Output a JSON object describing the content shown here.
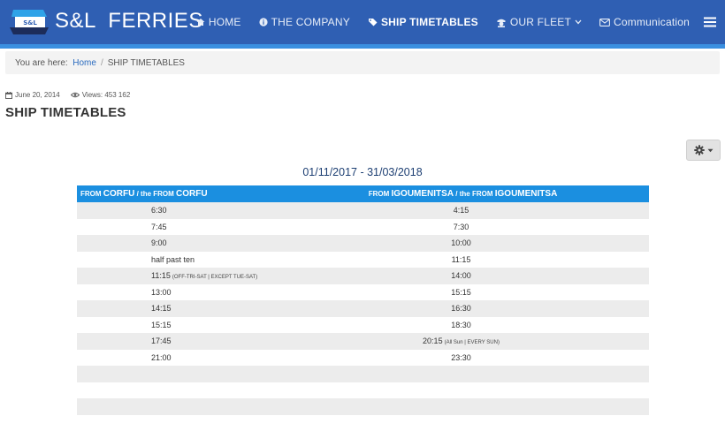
{
  "brand": {
    "name": "S&L  FERRIES",
    "logo_text": "S&L"
  },
  "nav": {
    "items": [
      {
        "label": "HOME",
        "icon": "home-icon"
      },
      {
        "label": "THE COMPANY",
        "icon": "info-circle-icon"
      },
      {
        "label": "SHIP TIMETABLES",
        "icon": "tag-icon",
        "active": true
      },
      {
        "label": "OUR FLEET",
        "icon": "captain-icon"
      },
      {
        "label": "Communication",
        "icon": "envelope-icon"
      }
    ],
    "menu_icon": "hamburger-menu-icon"
  },
  "breadcrumb": {
    "prefix": "You are here:",
    "home": "Home",
    "current": "SHIP TIMETABLES"
  },
  "article": {
    "date": "June 20, 2014",
    "views": "Views: 453 162",
    "title": "SHIP TIMETABLES",
    "tools_icon": "gear-icon"
  },
  "timetable": {
    "period": "01/11/2017 - 31/03/2018",
    "col1_small_a": "FROM",
    "col1_big": "CORFU",
    "col1_small_b": "/ the FROM",
    "col1_big_b": "CORFU",
    "col2_small_a": "FROM",
    "col2_big": "IGOUMENITSA",
    "col2_small_b": "/ the FROM",
    "col2_big_b": "IGOUMENITSA",
    "rows": [
      {
        "corfu": "6:30",
        "corfu_note": "",
        "igoumenitsa": "4:15",
        "igoumenitsa_note": ""
      },
      {
        "corfu": "7:45",
        "corfu_note": "",
        "igoumenitsa": "7:30",
        "igoumenitsa_note": ""
      },
      {
        "corfu": "9:00",
        "corfu_note": "",
        "igoumenitsa": "10:00",
        "igoumenitsa_note": ""
      },
      {
        "corfu": "half past ten",
        "corfu_note": "",
        "igoumenitsa": "11:15",
        "igoumenitsa_note": ""
      },
      {
        "corfu": "11:15",
        "corfu_note": "(OFF-TRI-SAT | EXCEPT TUE-SAT)",
        "igoumenitsa": "14:00",
        "igoumenitsa_note": ""
      },
      {
        "corfu": "13:00",
        "corfu_note": "",
        "igoumenitsa": "15:15",
        "igoumenitsa_note": ""
      },
      {
        "corfu": "14:15",
        "corfu_note": "",
        "igoumenitsa": "16:30",
        "igoumenitsa_note": ""
      },
      {
        "corfu": "15:15",
        "corfu_note": "",
        "igoumenitsa": "18:30",
        "igoumenitsa_note": ""
      },
      {
        "corfu": "17:45",
        "corfu_note": "",
        "igoumenitsa": "20:15",
        "igoumenitsa_note": "(All Sun | EVERY SUN)"
      },
      {
        "corfu": "21:00",
        "corfu_note": "",
        "igoumenitsa": "23:30",
        "igoumenitsa_note": ""
      },
      {
        "corfu": "",
        "corfu_note": "",
        "igoumenitsa": "",
        "igoumenitsa_note": ""
      },
      {
        "corfu": "",
        "corfu_note": "",
        "igoumenitsa": "",
        "igoumenitsa_note": ""
      },
      {
        "corfu": "",
        "corfu_note": "",
        "igoumenitsa": "",
        "igoumenitsa_note": ""
      },
      {
        "corfu": "",
        "corfu_note": "",
        "igoumenitsa": "",
        "igoumenitsa_note": ""
      }
    ]
  },
  "colors": {
    "navbar": "#2f5fb3",
    "navbar_stripe": "#3a8fe0",
    "table_header": "#1b8fe0",
    "row_shade": "#ececec",
    "period_text": "#1d3f73"
  }
}
